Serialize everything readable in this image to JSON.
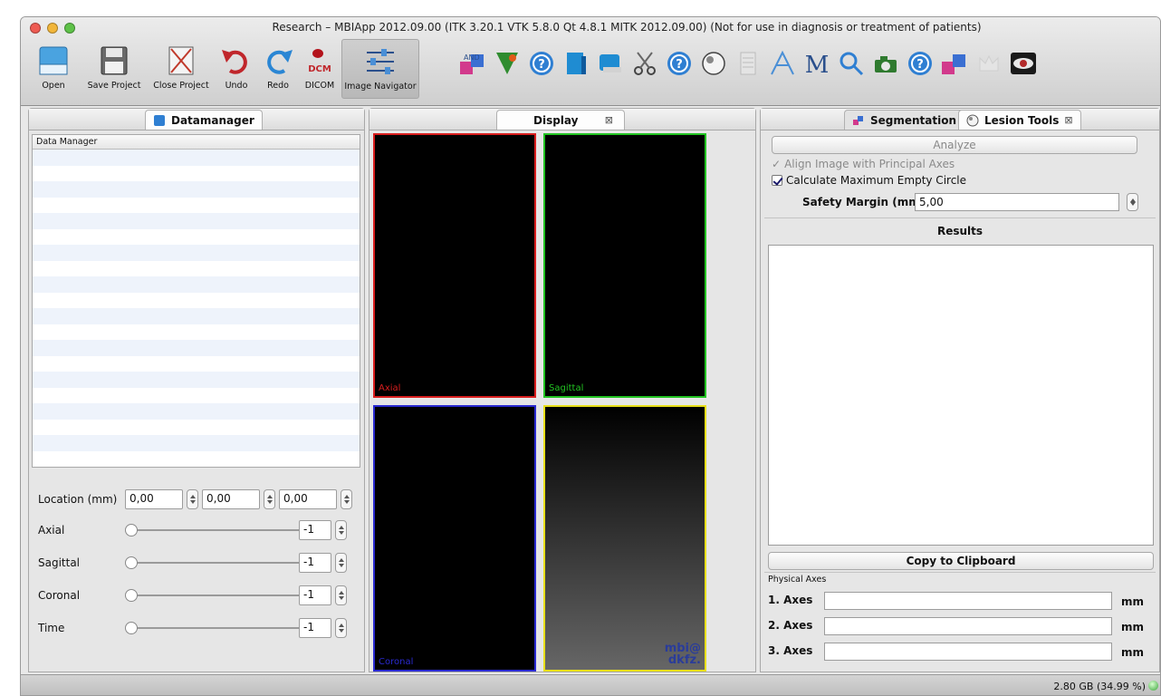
{
  "window": {
    "title": "Research – MBIApp 2012.09.00 (ITK 3.20.1  VTK 5.8.0 Qt 4.8.1 MITK 2012.09.00) (Not for use in diagnosis or treatment of patients)"
  },
  "toolbar": {
    "open": "Open",
    "save_project": "Save Project",
    "close_project": "Close Project",
    "undo": "Undo",
    "redo": "Redo",
    "dicom": "DICOM",
    "dicom_badge": "DCM",
    "image_navigator": "Image Navigator",
    "plugin_icons": [
      "segmentation-icon",
      "leaf-icon",
      "help-icon",
      "volume-icon",
      "book-icon",
      "scissors-icon",
      "help-icon",
      "lesion-icon",
      "document-icon",
      "measure-icon",
      "text-icon",
      "search-icon",
      "camera-icon",
      "help-icon",
      "segmentation-icon",
      "crown-icon",
      "eye-icon"
    ]
  },
  "datamanager": {
    "tab": "Datamanager",
    "header": "Data Manager",
    "location_label": "Location (mm)",
    "location": [
      "0,00",
      "0,00",
      "0,00"
    ],
    "sliders": [
      {
        "label": "Axial",
        "value": "-1"
      },
      {
        "label": "Sagittal",
        "value": "-1"
      },
      {
        "label": "Coronal",
        "value": "-1"
      },
      {
        "label": "Time",
        "value": "-1"
      }
    ]
  },
  "display": {
    "tab": "Display",
    "views": {
      "axial": "Axial",
      "sagittal": "Sagittal",
      "coronal": "Coronal",
      "logo_line1": "mbi@",
      "logo_line2": "dkfz."
    },
    "colors": {
      "axial": "#d81e1e",
      "sagittal": "#22c322",
      "coronal": "#2a2ad0",
      "three_d": "#e8df1a"
    }
  },
  "lesion": {
    "tab_segmentation": "Segmentation",
    "tab_lesion": "Lesion Tools",
    "analyze": "Analyze",
    "align_label": "Align Image with Principal Axes",
    "calc_label": "Calculate Maximum Empty Circle",
    "safety_label": "Safety Margin (mm)",
    "safety_value": "5,00",
    "results_label": "Results",
    "copy": "Copy to Clipboard",
    "physical_axes": "Physical Axes",
    "axes": [
      {
        "label": "1. Axes",
        "unit": "mm"
      },
      {
        "label": "2. Axes",
        "unit": "mm"
      },
      {
        "label": "3. Axes",
        "unit": "mm"
      }
    ]
  },
  "status": {
    "memory": "2.80 GB (34.99 %)"
  }
}
